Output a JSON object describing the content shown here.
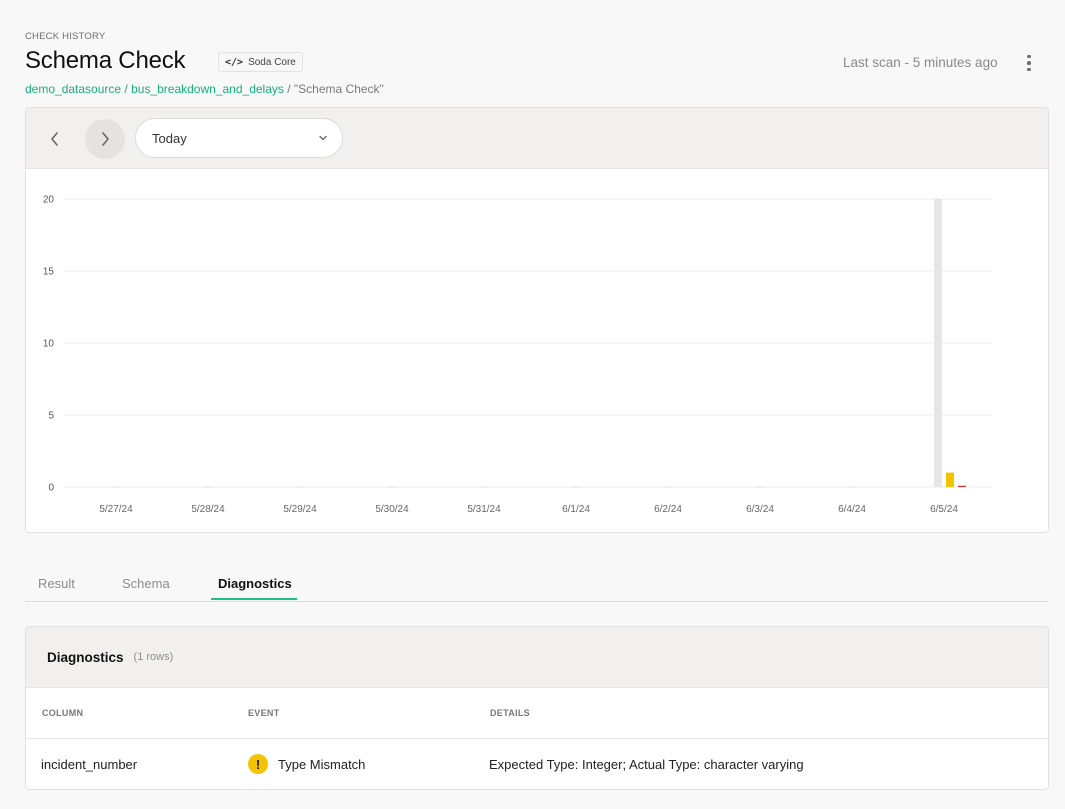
{
  "header": {
    "eyebrow": "CHECK HISTORY",
    "title": "Schema Check",
    "badge_icon": "</>",
    "badge_label": "Soda Core",
    "breadcrumb": {
      "datasource": "demo_datasource",
      "sep1": " / ",
      "dataset": "bus_breakdown_and_delays",
      "sep2": " / ",
      "check": "\"Schema Check\""
    },
    "last_scan": "Last scan - 5 minutes ago"
  },
  "toolbar": {
    "range_value": "Today"
  },
  "colors": {
    "accent_green": "#1dbf86",
    "link_green": "#16b07a",
    "warn_yellow": "#f5c400",
    "fail_red": "#d92c2c",
    "bar_grey": "#e6e6e6"
  },
  "chart_data": {
    "type": "bar",
    "categories": [
      "5/27/24",
      "5/28/24",
      "5/29/24",
      "5/30/24",
      "5/31/24",
      "6/1/24",
      "6/2/24",
      "6/3/24",
      "6/4/24",
      "6/5/24"
    ],
    "series": [
      {
        "values": [
          0,
          0,
          0,
          0,
          0,
          0,
          0,
          0,
          0,
          20
        ],
        "color": "#e6e6e6"
      },
      {
        "values": [
          0,
          0,
          0,
          0,
          0,
          0,
          0,
          0,
          0,
          1
        ],
        "color": "#f5c400"
      },
      {
        "values": [
          0,
          0,
          0,
          0,
          0,
          0,
          0,
          0,
          0,
          0.05
        ],
        "color": "#d92c2c"
      }
    ],
    "yticks": [
      0,
      5,
      10,
      15,
      20
    ],
    "ylim": [
      0,
      20
    ],
    "grid": true
  },
  "tabs": {
    "result": "Result",
    "schema": "Schema",
    "diagnostics": "Diagnostics"
  },
  "diagnostics": {
    "title": "Diagnostics",
    "count": "(1 rows)",
    "columns": [
      "COLUMN",
      "EVENT",
      "DETAILS"
    ],
    "rows": [
      {
        "column": "incident_number",
        "event_icon": "!",
        "event": "Type Mismatch",
        "details": "Expected Type: Integer; Actual Type: character varying"
      }
    ]
  }
}
